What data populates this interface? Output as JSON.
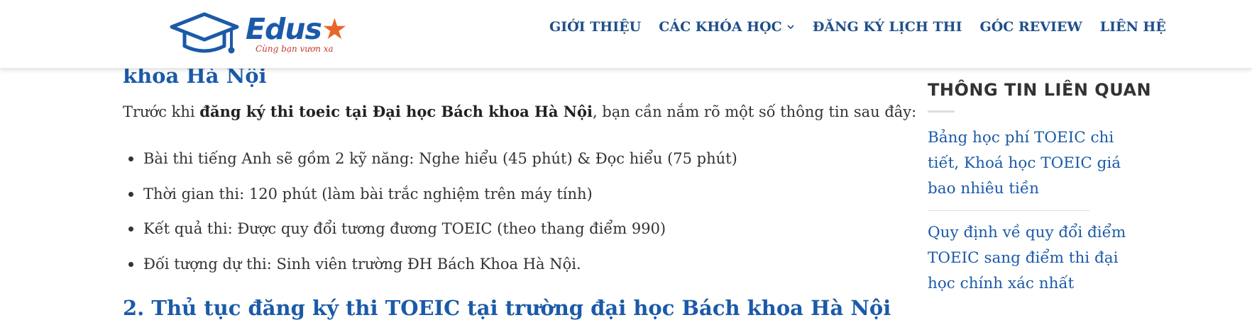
{
  "header": {
    "logo": {
      "brand_main": "Edus",
      "brand_accent": "★",
      "tagline": "Cùng bạn vươn xa"
    },
    "nav": [
      {
        "label": "GIỚI THIỆU"
      },
      {
        "label": "CÁC KHÓA HỌC",
        "has_dropdown": true
      },
      {
        "label": "ĐĂNG KÝ LỊCH THI"
      },
      {
        "label": "GÓC REVIEW"
      },
      {
        "label": "LIÊN HỆ"
      }
    ],
    "icons": {
      "chevron": "chevron-down-icon",
      "logo_cap": "graduation-cap-icon"
    }
  },
  "article": {
    "cut_heading": "khoa Hà Nội",
    "intro_prefix": "Trước khi ",
    "intro_bold": "đăng ký thi toeic tại Đại học Bách khoa Hà Nội",
    "intro_suffix": ", bạn cần nắm rõ một số thông tin sau đây:",
    "bullets": [
      "Bài thi tiếng Anh sẽ gồm 2 kỹ năng: Nghe hiểu (45 phút) & Đọc hiểu (75 phút)",
      "Thời gian thi: 120 phút (làm bài trắc nghiệm trên máy tính)",
      "Kết quả thi: Được quy đổi tương đương TOEIC (theo thang điểm 990)",
      "Đối tượng dự thi: Sinh viên trường ĐH Bách Khoa Hà Nội."
    ],
    "next_heading": "2. Thủ tục đăng ký thi TOEIC tại trường đại học Bách khoa Hà Nội"
  },
  "sidebar": {
    "title": "THÔNG TIN LIÊN QUAN",
    "links": [
      "Bảng học phí TOEIC chi tiết, Khoá học TOEIC giá bao nhiêu tiền",
      "Quy định về quy đổi điểm TOEIC sang điểm thi đại học chính xác nhất"
    ]
  },
  "colors": {
    "brand_blue": "#1b5aa8",
    "nav_blue": "#1f4f8b",
    "accent_orange": "#e8662b",
    "text": "#333333"
  }
}
